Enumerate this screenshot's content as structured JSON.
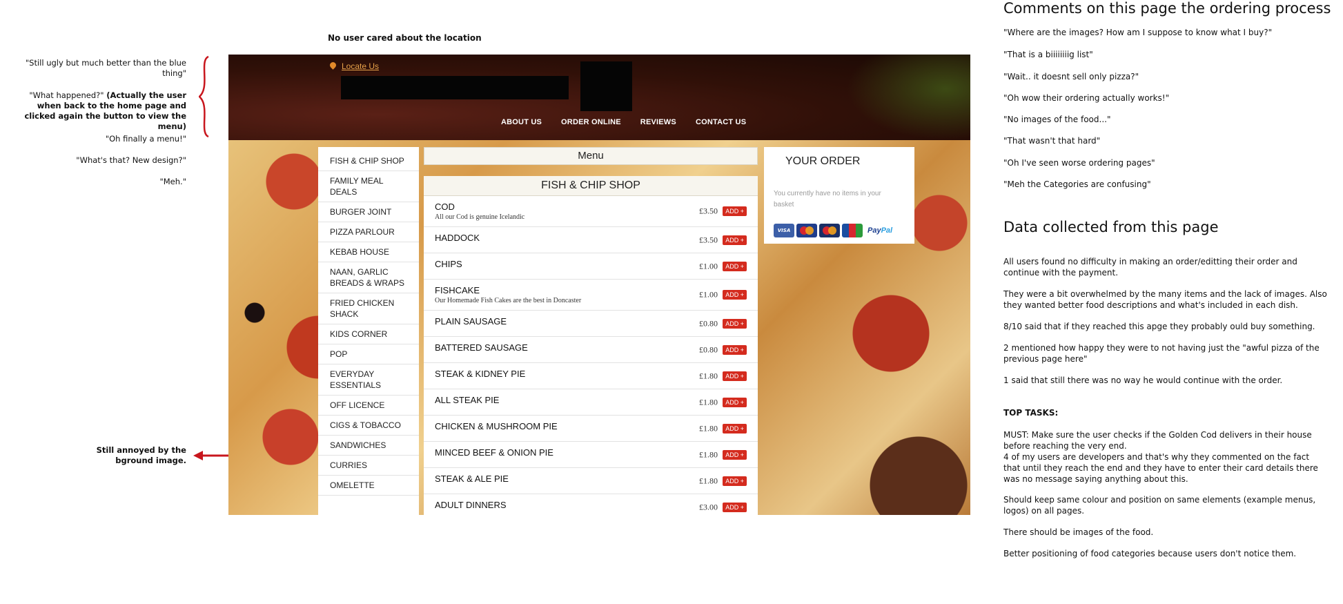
{
  "annotations": {
    "top": "No user cared about the location",
    "left": [
      "\"Still ugly but much better than the blue thing\"",
      "\"What happened?\"",
      "(Actually the user when back to the home page and clicked again the button to view the menu)",
      "\"Oh finally a menu!\"",
      "\"What's that? New design?\"",
      "\"Meh.\"",
      "Still annoyed by the bground image."
    ]
  },
  "site": {
    "locate": "Locate Us",
    "nav": [
      "ABOUT US",
      "ORDER ONLINE",
      "REVIEWS",
      "CONTACT US"
    ],
    "categories": [
      "FISH & CHIP SHOP",
      "FAMILY MEAL DEALS",
      "BURGER JOINT",
      "PIZZA PARLOUR",
      "KEBAB HOUSE",
      "NAAN, GARLIC BREADS & WRAPS",
      "FRIED CHICKEN SHACK",
      "KIDS CORNER",
      "POP",
      "EVERYDAY ESSENTIALS",
      "OFF LICENCE",
      "CIGS & TOBACCO",
      "SANDWICHES",
      "CURRIES",
      "OMELETTE"
    ],
    "menu_title": "Menu",
    "section": "FISH & CHIP SHOP",
    "add_label": "ADD +",
    "items": [
      {
        "name": "COD",
        "desc": "All our Cod is genuine Icelandic",
        "price": "£3.50"
      },
      {
        "name": "HADDOCK",
        "desc": "",
        "price": "£3.50"
      },
      {
        "name": "CHIPS",
        "desc": "",
        "price": "£1.00"
      },
      {
        "name": "FISHCAKE",
        "desc": "Our Homemade Fish Cakes are the best in Doncaster",
        "price": "£1.00"
      },
      {
        "name": "PLAIN SAUSAGE",
        "desc": "",
        "price": "£0.80"
      },
      {
        "name": "BATTERED SAUSAGE",
        "desc": "",
        "price": "£0.80"
      },
      {
        "name": "STEAK & KIDNEY PIE",
        "desc": "",
        "price": "£1.80"
      },
      {
        "name": "ALL STEAK PIE",
        "desc": "",
        "price": "£1.80"
      },
      {
        "name": "CHICKEN & MUSHROOM PIE",
        "desc": "",
        "price": "£1.80"
      },
      {
        "name": "MINCED BEEF & ONION PIE",
        "desc": "",
        "price": "£1.80"
      },
      {
        "name": "STEAK & ALE PIE",
        "desc": "",
        "price": "£1.80"
      },
      {
        "name": "ADULT DINNERS",
        "desc": "",
        "price": "£3.00"
      }
    ],
    "order": {
      "title": "YOUR ORDER",
      "empty": "You currently have no items in your basket",
      "cards": [
        "VISA",
        "maestro",
        "mastercard",
        "JCB"
      ],
      "paypal_a": "Pay",
      "paypal_b": "Pal"
    }
  },
  "comments": {
    "title": "Comments on this page the ordering process",
    "quotes": [
      "\"Where are the images? How am I suppose to know what I buy?\"",
      "\"That is a biiiiiiiig list\"",
      "\"Wait.. it doesnt sell only pizza?\"",
      "\"Oh wow their ordering actually works!\"",
      "\"No images of the food...\"",
      "\"That wasn't that hard\"",
      "\"Oh I've seen worse ordering pages\"",
      "\"Meh the Categories are confusing\""
    ]
  },
  "data": {
    "title": "Data collected from this page",
    "paragraphs": [
      "All users found no difficulty in making an order/editting their order and continue with the payment.",
      "They were a bit overwhelmed by the many items and the lack of images. Also they wanted better food descriptions and what's included in each dish.",
      "8/10 said that if they reached this apge they probably ould buy something.",
      "2 mentioned how happy they were to not having just the \"awful pizza of the previous page here\"",
      "1 said that still there was no way he would continue with the order."
    ],
    "tasks_title": "TOP TASKS:",
    "tasks": [
      "MUST: Make sure the user checks if the Golden Cod delivers in their house before reaching the very end.",
      "4 of my users are developers and that's why they commented on the fact that until they reach the end and they have to enter their card details there was no message saying anything about this.",
      "Should keep same colour and position on same elements (example menus, logos) on all pages.",
      "There should be images of the food.",
      "Better positioning of food categories because users don't notice them."
    ]
  },
  "colors": {
    "annotation_red": "#c8161d",
    "add_button": "#d42b1e"
  }
}
